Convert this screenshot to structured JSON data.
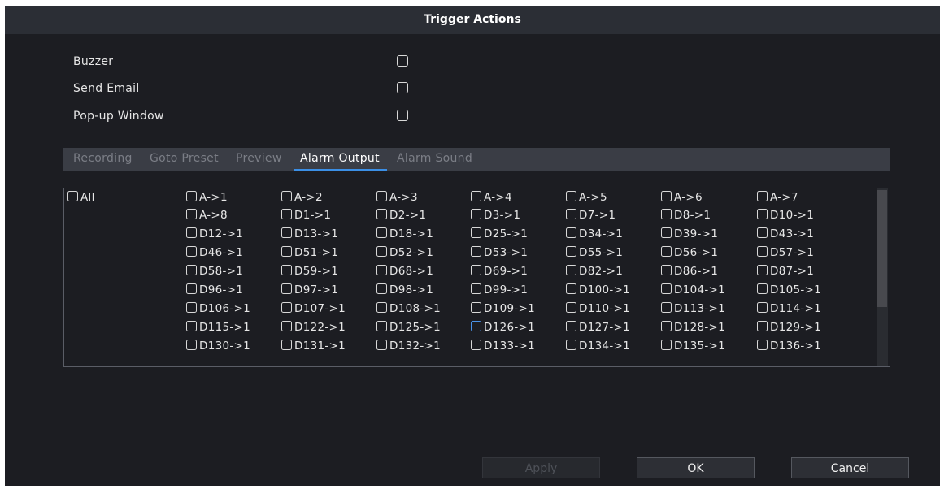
{
  "dialog": {
    "title": "Trigger Actions"
  },
  "options": [
    {
      "label": "Buzzer",
      "checked": false
    },
    {
      "label": "Send Email",
      "checked": false
    },
    {
      "label": "Pop-up Window",
      "checked": false
    }
  ],
  "tabs": [
    {
      "label": "Recording",
      "active": false
    },
    {
      "label": "Goto Preset",
      "active": false
    },
    {
      "label": "Preview",
      "active": false
    },
    {
      "label": "Alarm Output",
      "active": true
    },
    {
      "label": "Alarm Sound",
      "active": false
    }
  ],
  "alarm_outputs": {
    "all_label": "All",
    "rows": [
      [
        "A->1",
        "A->2",
        "A->3",
        "A->4",
        "A->5",
        "A->6",
        "A->7"
      ],
      [
        "A->8",
        "D1->1",
        "D2->1",
        "D3->1",
        "D7->1",
        "D8->1",
        "D10->1"
      ],
      [
        "D12->1",
        "D13->1",
        "D18->1",
        "D25->1",
        "D34->1",
        "D39->1",
        "D43->1"
      ],
      [
        "D46->1",
        "D51->1",
        "D52->1",
        "D53->1",
        "D55->1",
        "D56->1",
        "D57->1"
      ],
      [
        "D58->1",
        "D59->1",
        "D68->1",
        "D69->1",
        "D82->1",
        "D86->1",
        "D87->1"
      ],
      [
        "D96->1",
        "D97->1",
        "D98->1",
        "D99->1",
        "D100->1",
        "D104->1",
        "D105->1"
      ],
      [
        "D106->1",
        "D107->1",
        "D108->1",
        "D109->1",
        "D110->1",
        "D113->1",
        "D114->1"
      ],
      [
        "D115->1",
        "D122->1",
        "D125->1",
        "D126->1",
        "D127->1",
        "D128->1",
        "D129->1"
      ],
      [
        "D130->1",
        "D131->1",
        "D132->1",
        "D133->1",
        "D134->1",
        "D135->1",
        "D136->1"
      ]
    ],
    "focused_item": "D126->1"
  },
  "buttons": {
    "apply": "Apply",
    "ok": "OK",
    "cancel": "Cancel"
  },
  "colors": {
    "accent": "#3b8fe6",
    "background": "#1c1d22",
    "titlebar": "#2b2e35"
  }
}
